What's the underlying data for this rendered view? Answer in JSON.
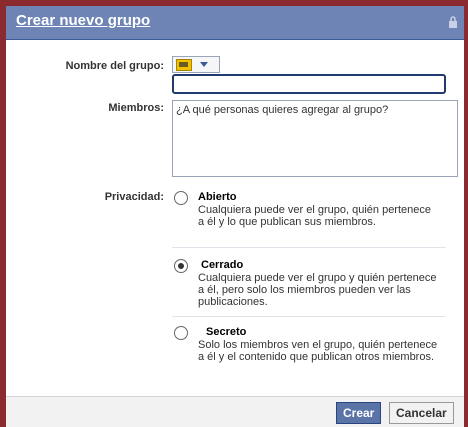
{
  "dialog": {
    "title": "Crear nuevo grupo",
    "lock_icon": "lock-icon"
  },
  "form": {
    "group_name_label": "Nombre del grupo:",
    "group_name_value": "",
    "members_label": "Miembros:",
    "members_placeholder": "¿A qué personas quieres agregar al grupo?",
    "privacy_label": "Privacidad:",
    "privacy_options": [
      {
        "title": "Abierto",
        "description": "Cualquiera puede ver el grupo, quién pertenece a él y lo que publican sus miembros.",
        "selected": false
      },
      {
        "title": "Cerrado",
        "description": "Cualquiera puede ver el grupo y quién pertenece a él, pero solo los miembros pueden ver las publicaciones.",
        "selected": true
      },
      {
        "title": "Secreto",
        "description": "Solo los miembros ven el grupo, quién pertenece a él y el contenido que publican otros miembros.",
        "selected": false
      }
    ]
  },
  "buttons": {
    "create": "Crear",
    "cancel": "Cancelar"
  },
  "colors": {
    "titlebar": "#6d84b4",
    "primary_button": "#5b74a8",
    "outer_frame": "#8b2b2f"
  }
}
